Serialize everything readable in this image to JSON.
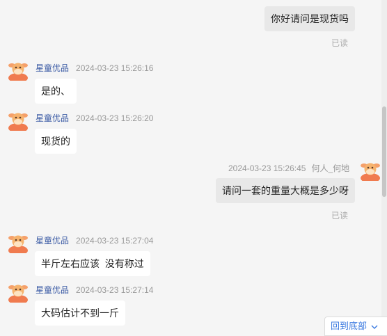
{
  "messages": [
    {
      "text": "你好请问是现货吗",
      "read": "已读"
    },
    {
      "name": "星童优品",
      "time": "2024-03-23 15:26:16",
      "text": "是的、"
    },
    {
      "name": "星童优品",
      "time": "2024-03-23 15:26:20",
      "text": "现货的"
    },
    {
      "name": "何人_何地",
      "time": "2024-03-23 15:26:45",
      "text": "请问一套的重量大概是多少呀",
      "read": "已读"
    },
    {
      "name": "星童优品",
      "time": "2024-03-23 15:27:04",
      "text": "半斤左右应该  没有称过"
    },
    {
      "name": "星童优品",
      "time": "2024-03-23 15:27:14",
      "text": "大码估计不到一斤"
    }
  ],
  "back_to_bottom": "回到底部",
  "icons": {
    "avatar": "cartoon-cow-avatar-icon",
    "chevron": "chevron-down-icon"
  }
}
